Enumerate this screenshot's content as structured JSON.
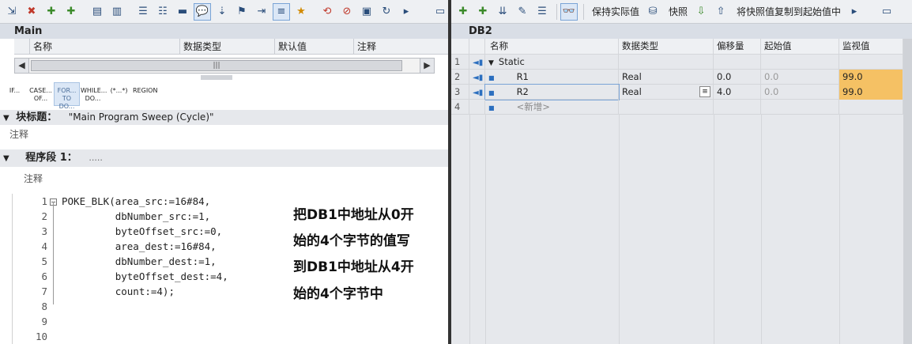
{
  "left": {
    "toolbar_icons": [
      "insert-network-icon",
      "delete-network-icon",
      "insert-row-icon",
      "add-row-icon",
      "insert-block-icon",
      "open-block-icon",
      "network-view-icon",
      "comments-icon",
      "comment-toggle-icon",
      "favorites-icon"
    ],
    "title": "Main",
    "interface_columns": [
      "名称",
      "数据类型",
      "默认值",
      "注释"
    ],
    "instructions": [
      {
        "line1": "IF...",
        "line2": ""
      },
      {
        "line1": "CASE...",
        "line2": "OF..."
      },
      {
        "line1": "FOR...",
        "line2": "TO DO..."
      },
      {
        "line1": "WHILE...",
        "line2": "DO..."
      },
      {
        "line1": "(*...*)",
        "line2": ""
      },
      {
        "line1": "REGION",
        "line2": ""
      }
    ],
    "block_title_label": "块标题：",
    "block_title_value": "\"Main Program Sweep (Cycle)\"",
    "block_comment": "注释",
    "network_label": "程序段 1：",
    "network_title": ".....",
    "network_comment": "注释",
    "code_lines": [
      {
        "n": "1",
        "text": "POKE_BLK(area_src:=16#84,"
      },
      {
        "n": "2",
        "text": "         dbNumber_src:=1,"
      },
      {
        "n": "3",
        "text": "         byteOffset_src:=0,"
      },
      {
        "n": "4",
        "text": "         area_dest:=16#84,"
      },
      {
        "n": "5",
        "text": "         dbNumber_dest:=1,"
      },
      {
        "n": "6",
        "text": "         byteOffset_dest:=4,"
      },
      {
        "n": "7",
        "text": "         count:=4);"
      },
      {
        "n": "8",
        "text": ""
      },
      {
        "n": "9",
        "text": ""
      },
      {
        "n": "10",
        "text": ""
      }
    ],
    "annotation": [
      "把DB1中地址从0开",
      "始的4个字节的值写",
      "到DB1中地址从4开",
      "始的4个字节中"
    ]
  },
  "right": {
    "toolbar": {
      "keep_actual": "保持实际值",
      "snapshot": "快照",
      "copy_snapshot": "将快照值复制到起始值中"
    },
    "title": "DB2",
    "columns": [
      "名称",
      "数据类型",
      "偏移量",
      "起始值",
      "监视值"
    ],
    "rows": [
      {
        "num": "1",
        "name": "Static",
        "type": "",
        "offset": "",
        "start": "",
        "monitor": ""
      },
      {
        "num": "2",
        "name": "R1",
        "type": "Real",
        "offset": "0.0",
        "start": "0.0",
        "monitor": "99.0"
      },
      {
        "num": "3",
        "name": "R2",
        "type": "Real",
        "offset": "4.0",
        "start": "0.0",
        "monitor": "99.0"
      },
      {
        "num": "4",
        "name": "<新增>",
        "type": "",
        "offset": "",
        "start": "",
        "monitor": ""
      }
    ],
    "monitor_color": "#f5c164"
  }
}
